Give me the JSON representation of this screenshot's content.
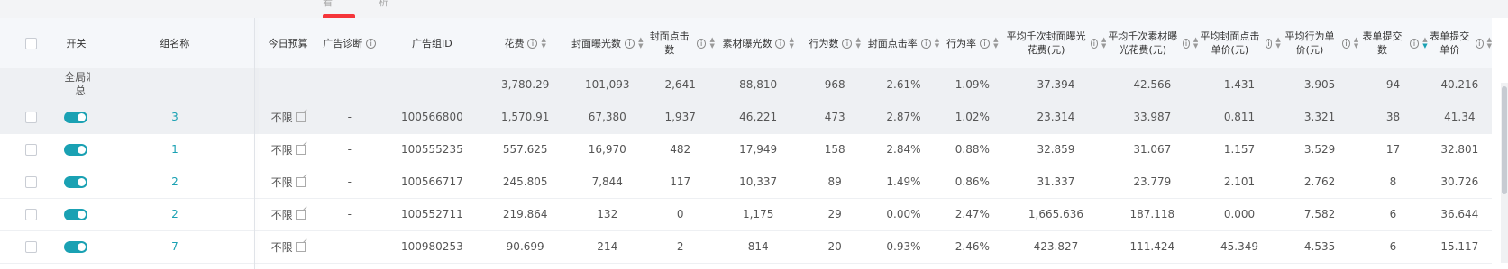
{
  "top_tabs": [
    "看",
    "析"
  ],
  "columns": [
    {
      "key": "check",
      "label": ""
    },
    {
      "key": "switch",
      "label": "开关"
    },
    {
      "key": "name",
      "label": "组名称"
    },
    {
      "key": "budget",
      "label": "今日预算"
    },
    {
      "key": "diag",
      "label": "广告诊断"
    },
    {
      "key": "id",
      "label": "广告组ID"
    },
    {
      "key": "cost",
      "label": "花费"
    },
    {
      "key": "cover_imp",
      "label": "封面曝光数"
    },
    {
      "key": "cover_click",
      "label": "封面点击数"
    },
    {
      "key": "mat_imp",
      "label": "素材曝光数"
    },
    {
      "key": "actions",
      "label": "行为数"
    },
    {
      "key": "cover_ctr",
      "label": "封面点击率"
    },
    {
      "key": "action_rate",
      "label": "行为率"
    },
    {
      "key": "cpm_cover",
      "label": "平均千次封面曝光花费(元)"
    },
    {
      "key": "cpm_mat",
      "label": "平均千次素材曝光花费(元)"
    },
    {
      "key": "cpc_cover",
      "label": "平均封面点击单价(元)"
    },
    {
      "key": "cpa",
      "label": "平均行为单价(元)"
    },
    {
      "key": "forms",
      "label": "表单提交数"
    },
    {
      "key": "form_price",
      "label": "表单提交单价"
    }
  ],
  "summary": {
    "label": "全局汇总",
    "name": "-",
    "budget": "-",
    "diag": "-",
    "id": "-",
    "cost": "3,780.29",
    "cover_imp": "101,093",
    "cover_click": "2,641",
    "mat_imp": "88,810",
    "actions": "968",
    "cover_ctr": "2.61%",
    "action_rate": "1.09%",
    "cpm_cover": "37.394",
    "cpm_mat": "42.566",
    "cpc_cover": "1.431",
    "cpa": "3.905",
    "forms": "94",
    "form_price": "40.216"
  },
  "rows": [
    {
      "name": "3",
      "budget": "不限",
      "diag": "-",
      "id": "100566800",
      "cost": "1,570.91",
      "cover_imp": "67,380",
      "cover_click": "1,937",
      "mat_imp": "46,221",
      "actions": "473",
      "cover_ctr": "2.87%",
      "action_rate": "1.02%",
      "cpm_cover": "23.314",
      "cpm_mat": "33.987",
      "cpc_cover": "0.811",
      "cpa": "3.321",
      "forms": "38",
      "form_price": "41.34"
    },
    {
      "name": "1",
      "budget": "不限",
      "diag": "-",
      "id": "100555235",
      "cost": "557.625",
      "cover_imp": "16,970",
      "cover_click": "482",
      "mat_imp": "17,949",
      "actions": "158",
      "cover_ctr": "2.84%",
      "action_rate": "0.88%",
      "cpm_cover": "32.859",
      "cpm_mat": "31.067",
      "cpc_cover": "1.157",
      "cpa": "3.529",
      "forms": "17",
      "form_price": "32.801"
    },
    {
      "name": "2",
      "budget": "不限",
      "diag": "-",
      "id": "100566717",
      "cost": "245.805",
      "cover_imp": "7,844",
      "cover_click": "117",
      "mat_imp": "10,337",
      "actions": "89",
      "cover_ctr": "1.49%",
      "action_rate": "0.86%",
      "cpm_cover": "31.337",
      "cpm_mat": "23.779",
      "cpc_cover": "2.101",
      "cpa": "2.762",
      "forms": "8",
      "form_price": "30.726"
    },
    {
      "name": "2",
      "budget": "不限",
      "diag": "-",
      "id": "100552711",
      "cost": "219.864",
      "cover_imp": "132",
      "cover_click": "0",
      "mat_imp": "1,175",
      "actions": "29",
      "cover_ctr": "0.00%",
      "action_rate": "2.47%",
      "cpm_cover": "1,665.636",
      "cpm_mat": "187.118",
      "cpc_cover": "0.000",
      "cpa": "7.582",
      "forms": "6",
      "form_price": "36.644"
    },
    {
      "name": "7",
      "budget": "不限",
      "diag": "-",
      "id": "100980253",
      "cost": "90.699",
      "cover_imp": "214",
      "cover_click": "2",
      "mat_imp": "814",
      "actions": "20",
      "cover_ctr": "0.93%",
      "action_rate": "2.46%",
      "cpm_cover": "423.827",
      "cpm_mat": "111.424",
      "cpc_cover": "45.349",
      "cpa": "4.535",
      "forms": "6",
      "form_price": "15.117"
    }
  ],
  "colors": {
    "accent": "#1aa1b3",
    "badge": "#f5353a",
    "header_bg": "#f5f7fa"
  }
}
